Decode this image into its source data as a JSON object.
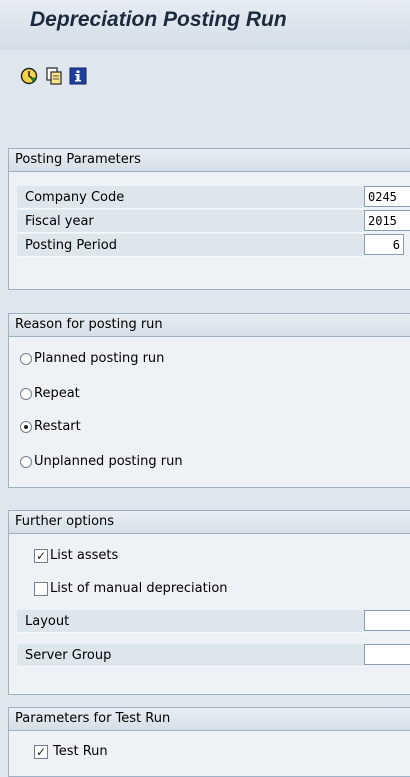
{
  "window": {
    "title": "Depreciation Posting Run"
  },
  "toolbar": {
    "icons": [
      "execute-icon",
      "copy-variant-icon",
      "info-icon"
    ]
  },
  "posting_parameters": {
    "header": "Posting Parameters",
    "company_code": {
      "label": "Company Code",
      "value": "0245"
    },
    "fiscal_year": {
      "label": "Fiscal year",
      "value": "2015"
    },
    "posting_period": {
      "label": "Posting Period",
      "value": "6"
    }
  },
  "reason": {
    "header": "Reason for posting run",
    "options": [
      {
        "label": "Planned posting run",
        "selected": false
      },
      {
        "label": "Repeat",
        "selected": false
      },
      {
        "label": "Restart",
        "selected": true
      },
      {
        "label": "Unplanned posting run",
        "selected": false
      }
    ]
  },
  "further_options": {
    "header": "Further options",
    "list_assets": {
      "label": "List assets",
      "checked": true
    },
    "list_manual_depreciation": {
      "label": "List of manual depreciation",
      "checked": false
    },
    "layout": {
      "label": "Layout",
      "value": ""
    },
    "server_group": {
      "label": "Server Group",
      "value": ""
    }
  },
  "test_run": {
    "header": "Parameters for Test Run",
    "test_run": {
      "label": "Test Run",
      "checked": true
    }
  }
}
